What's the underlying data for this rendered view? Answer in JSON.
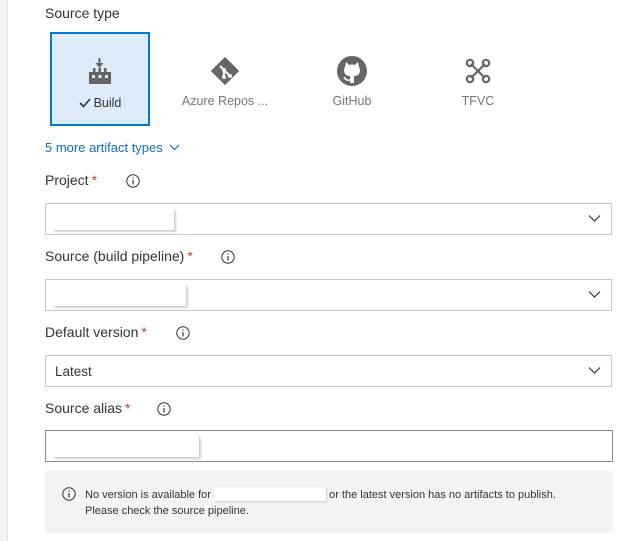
{
  "source_type": {
    "label": "Source type",
    "tiles": [
      {
        "label": "Build",
        "icon": "build-icon",
        "selected": true
      },
      {
        "label": "Azure Repos ...",
        "icon": "git-icon",
        "selected": false
      },
      {
        "label": "GitHub",
        "icon": "github-icon",
        "selected": false
      },
      {
        "label": "TFVC",
        "icon": "tfvc-icon",
        "selected": false
      }
    ],
    "more_link": "5 more artifact types"
  },
  "fields": {
    "project": {
      "label": "Project",
      "required": "*",
      "value": ""
    },
    "source": {
      "label": "Source (build pipeline)",
      "required": "*",
      "value": ""
    },
    "default_version": {
      "label": "Default version",
      "required": "*",
      "value": "Latest"
    },
    "source_alias": {
      "label": "Source alias",
      "required": "*",
      "value": ""
    }
  },
  "message": {
    "text_before": "No version is available for",
    "text_after": "or the latest version has no artifacts to publish.",
    "line2": "Please check the source pipeline."
  },
  "colors": {
    "accent": "#0078d4",
    "selected_bg": "#deecf9",
    "required": "#d13438",
    "link": "#106ebe"
  }
}
